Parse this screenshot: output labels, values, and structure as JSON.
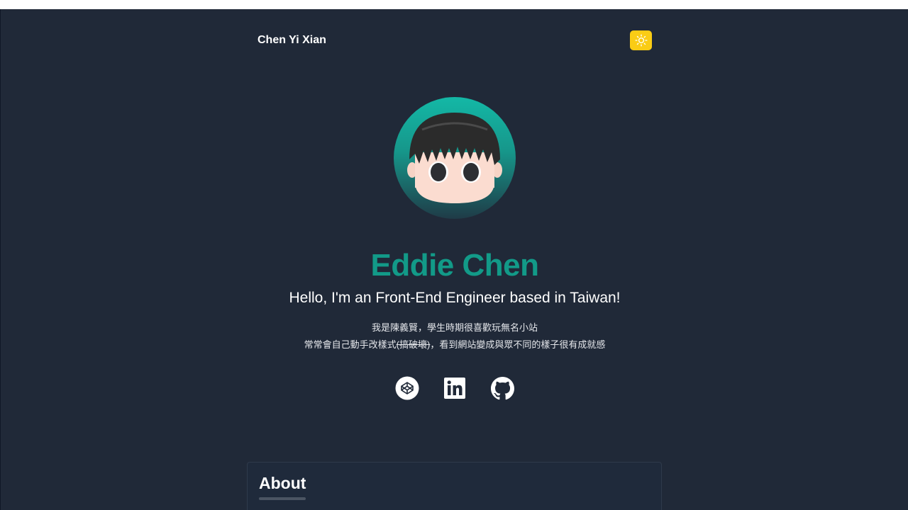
{
  "header": {
    "site_name": "Chen Yi Xian",
    "theme_toggle_icon": "sun-icon",
    "accent_color": "#facc15"
  },
  "hero": {
    "name": "Eddie Chen",
    "name_color": "#129a88",
    "tagline": "Hello, I'm an Front-End Engineer based in Taiwan!",
    "bio_line1": "我是陳義賢，學生時期很喜歡玩無名小站",
    "bio_line2_before": "常常會自己動手改樣式",
    "bio_line2_strike": "(搞破壞)",
    "bio_line2_after": "，看到網站變成與眾不同的樣子很有成就感"
  },
  "socials": [
    {
      "icon": "codepen-icon"
    },
    {
      "icon": "linkedin-icon"
    },
    {
      "icon": "github-icon"
    }
  ],
  "about": {
    "title": "About"
  }
}
